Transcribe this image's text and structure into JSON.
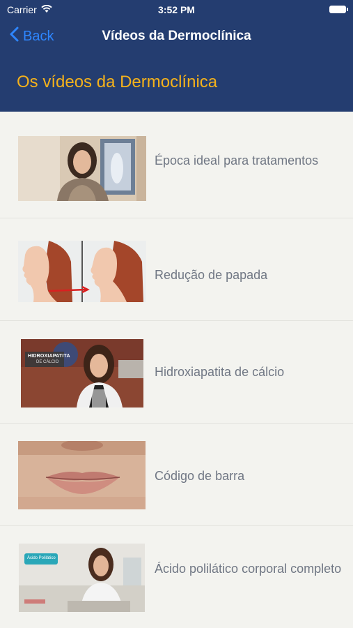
{
  "status": {
    "carrier": "Carrier",
    "time": "3:52 PM"
  },
  "nav": {
    "back_label": "Back",
    "title": "Vídeos da Dermoclínica"
  },
  "section": {
    "title": "Os vídeos da Dermoclínica"
  },
  "videos": [
    {
      "title": "Época ideal para tratamentos",
      "thumb": "woman-speaking-thumbnail"
    },
    {
      "title": "Redução de papada",
      "thumb": "chin-profile-comparison-thumbnail"
    },
    {
      "title": "Hidroxiapatita de cálcio",
      "thumb": "doctor-clinic-thumbnail",
      "overlay_line1": "HIDROXIAPATITA",
      "overlay_line2": "DE CÁLCIO"
    },
    {
      "title": "Código de barra",
      "thumb": "lips-closeup-thumbnail"
    },
    {
      "title": "Ácido polilático corporal completo",
      "thumb": "doctor-seated-thumbnail",
      "overlay_line1": "Ácido Polilático"
    }
  ],
  "colors": {
    "nav_bg": "#243d70",
    "accent": "#f5b21b",
    "back": "#2e86ff",
    "text": "#707784"
  }
}
